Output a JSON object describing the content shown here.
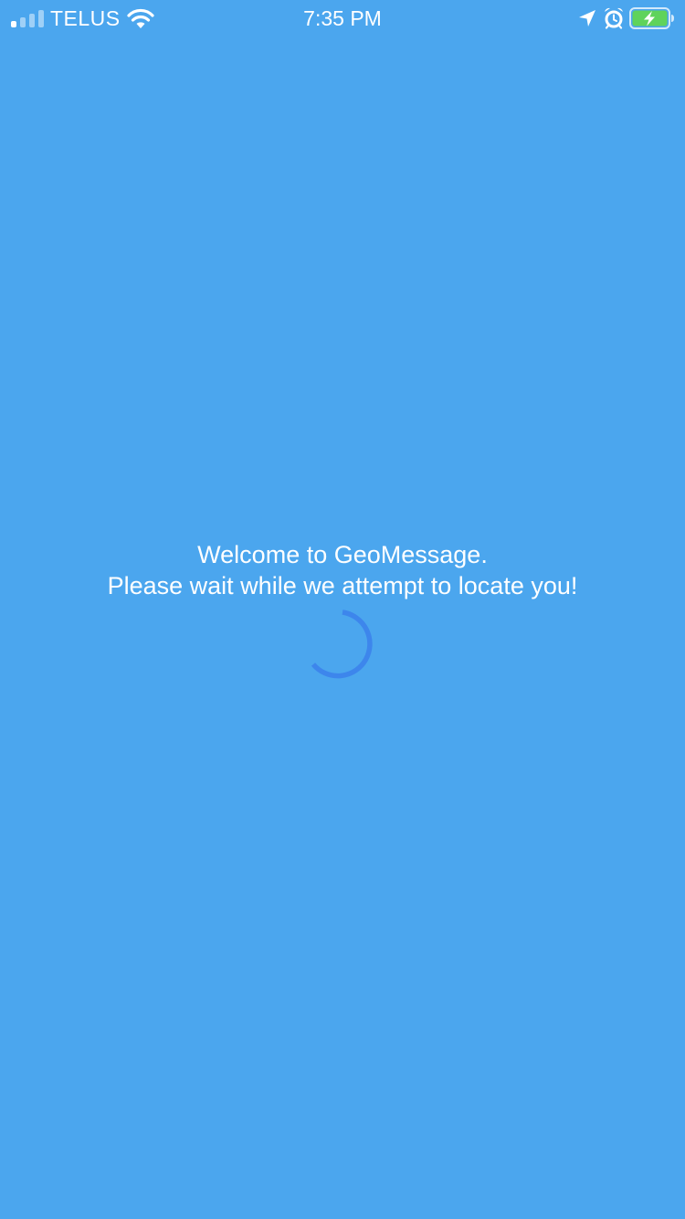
{
  "status_bar": {
    "carrier": "TELUS",
    "time": "7:35 PM",
    "signal_bars_active": 1,
    "signal_bars_total": 4,
    "icons": [
      "signal-bars-icon",
      "wifi-icon",
      "location-arrow-icon",
      "alarm-clock-icon",
      "battery-charging-icon"
    ]
  },
  "main": {
    "welcome_text": "Welcome to GeoMessage.",
    "wait_text": "Please wait while we attempt to locate you!"
  },
  "colors": {
    "background": "#4ba6ee",
    "text": "#ffffff",
    "spinner": "#3d86ec",
    "battery_fill": "#5fd35b",
    "signal_inactive": "#9fd0f7"
  }
}
